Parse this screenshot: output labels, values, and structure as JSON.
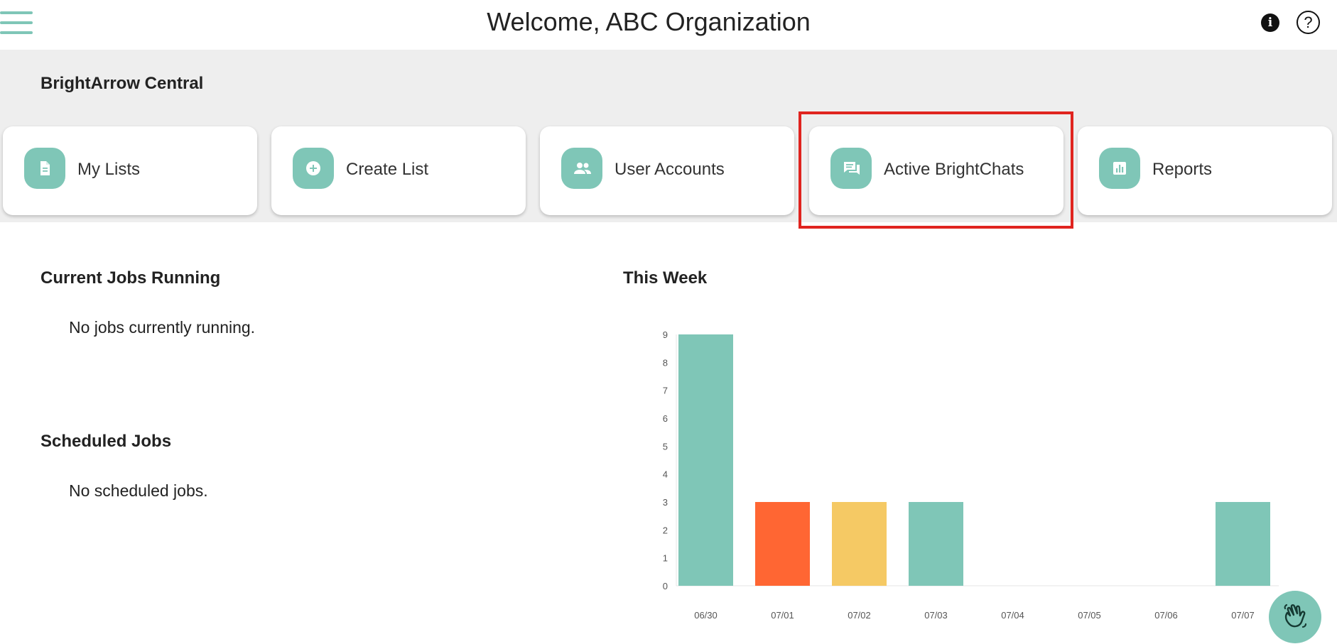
{
  "header": {
    "title": "Welcome, ABC Organization",
    "info_icon": "i",
    "help_icon": "?"
  },
  "central": {
    "title": "BrightArrow Central",
    "cards": [
      {
        "label": "My Lists",
        "icon": "document-icon"
      },
      {
        "label": "Create List",
        "icon": "plus-circle-icon"
      },
      {
        "label": "User Accounts",
        "icon": "people-icon"
      },
      {
        "label": "Active BrightChats",
        "icon": "chat-icon"
      },
      {
        "label": "Reports",
        "icon": "bar-chart-icon"
      }
    ]
  },
  "jobs": {
    "current_title": "Current Jobs Running",
    "current_empty": "No jobs currently running.",
    "scheduled_title": "Scheduled Jobs",
    "scheduled_empty": "No scheduled jobs."
  },
  "week": {
    "title": "This Week"
  },
  "colors": {
    "accent": "#7fc6b7",
    "orange": "#ff6633",
    "yellow": "#f5c964",
    "highlight": "#e0241f"
  },
  "chart_data": {
    "type": "bar",
    "categories": [
      "06/30",
      "07/01",
      "07/02",
      "07/03",
      "07/04",
      "07/05",
      "07/06",
      "07/07"
    ],
    "values": [
      9,
      3,
      3,
      3,
      0,
      0,
      0,
      3
    ],
    "colors": [
      "#7fc6b7",
      "#ff6633",
      "#f5c964",
      "#7fc6b7",
      "#7fc6b7",
      "#7fc6b7",
      "#7fc6b7",
      "#7fc6b7"
    ],
    "ylim": [
      0,
      9
    ],
    "yticks": [
      0,
      1,
      2,
      3,
      4,
      5,
      6,
      7,
      8,
      9
    ],
    "grid": false,
    "legend": "none"
  }
}
